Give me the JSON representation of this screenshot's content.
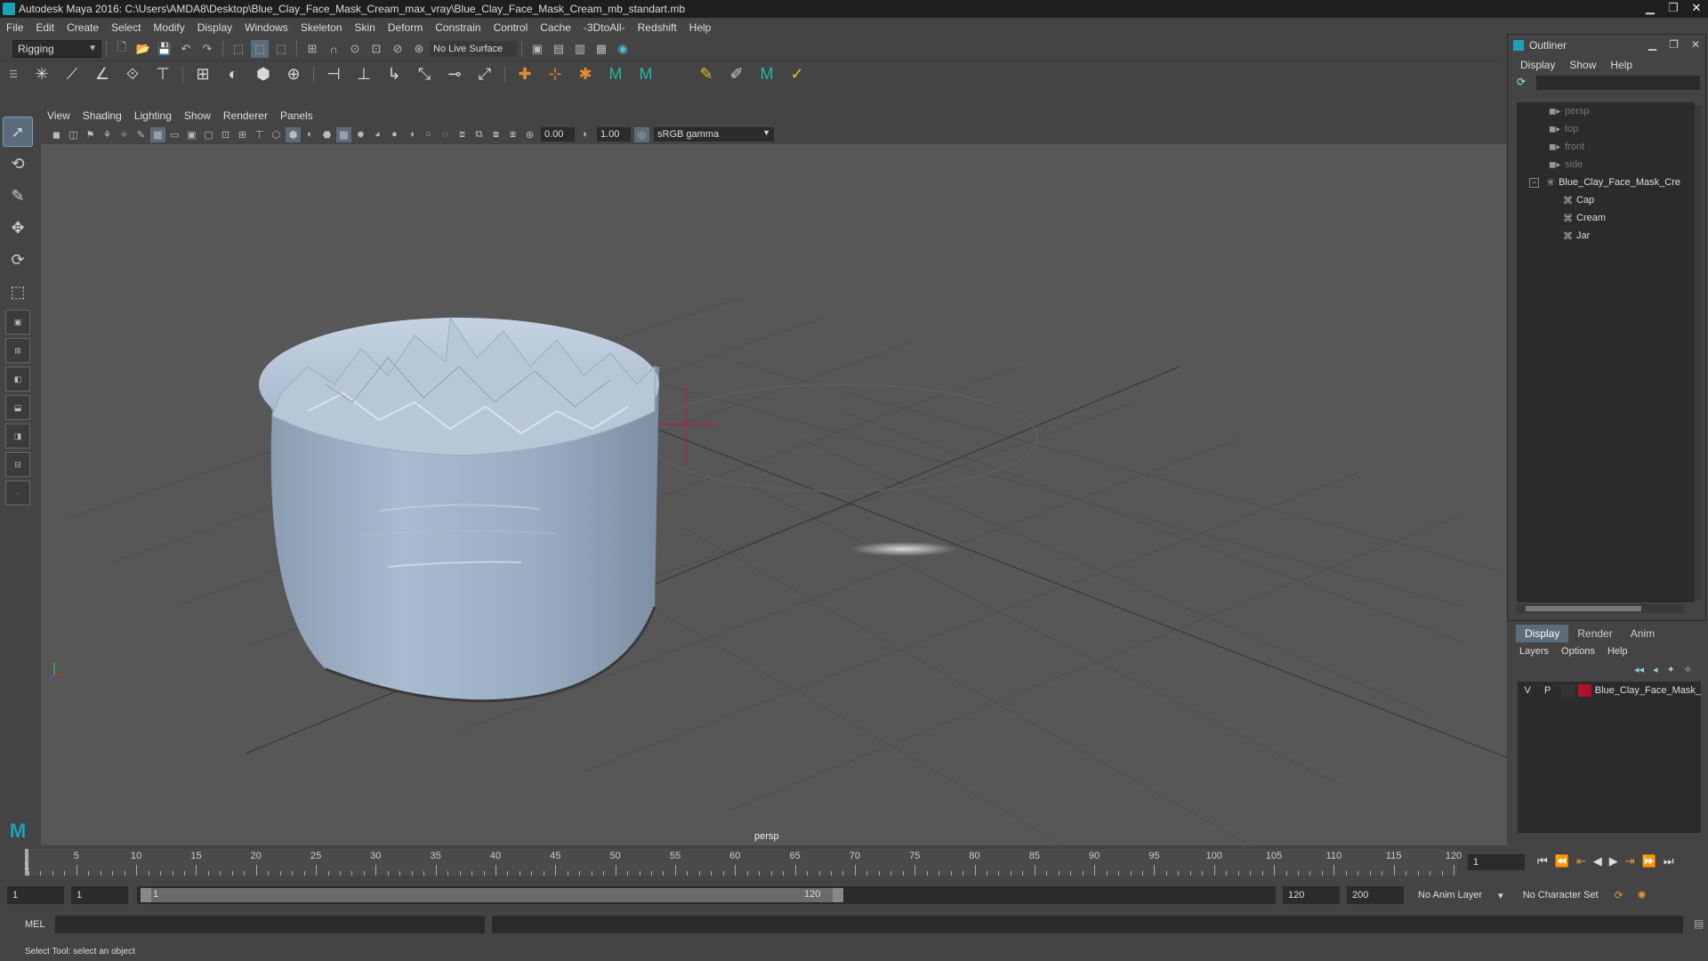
{
  "window": {
    "title": "Autodesk Maya 2016: C:\\Users\\AMDA8\\Desktop\\Blue_Clay_Face_Mask_Cream_max_vray\\Blue_Clay_Face_Mask_Cream_mb_standart.mb",
    "minimize": "▁",
    "restore": "❐",
    "close": "✕"
  },
  "menubar": [
    "File",
    "Edit",
    "Create",
    "Select",
    "Modify",
    "Display",
    "Windows",
    "Skeleton",
    "Skin",
    "Deform",
    "Constrain",
    "Control",
    "Cache",
    "-3DtoAll-",
    "Redshift",
    "Help"
  ],
  "statusline": {
    "mode": "Rigging",
    "live_surface": "No Live Surface"
  },
  "viewport": {
    "menu": [
      "View",
      "Shading",
      "Lighting",
      "Show",
      "Renderer",
      "Panels"
    ],
    "exposure": "0.00",
    "gamma_value": "1.00",
    "color_space": "sRGB gamma",
    "camera_label": "persp"
  },
  "outliner": {
    "title": "Outliner",
    "menu": [
      "Display",
      "Show",
      "Help"
    ],
    "items": [
      {
        "label": "persp",
        "kind": "camera"
      },
      {
        "label": "top",
        "kind": "camera"
      },
      {
        "label": "front",
        "kind": "camera"
      },
      {
        "label": "side",
        "kind": "camera"
      },
      {
        "label": "Blue_Clay_Face_Mask_Cre",
        "kind": "group"
      },
      {
        "label": "Cap",
        "kind": "mesh"
      },
      {
        "label": "Cream",
        "kind": "mesh"
      },
      {
        "label": "Jar",
        "kind": "mesh"
      }
    ]
  },
  "layers": {
    "tabs": [
      "Display",
      "Render",
      "Anim"
    ],
    "menu": [
      "Layers",
      "Options",
      "Help"
    ],
    "rows": [
      {
        "v": "V",
        "p": "P",
        "name": "Blue_Clay_Face_Mask_",
        "color": "#b0102a"
      }
    ]
  },
  "timeline": {
    "ticks": [
      "5",
      "10",
      "15",
      "20",
      "25",
      "30",
      "35",
      "40",
      "45",
      "50",
      "55",
      "60",
      "65",
      "70",
      "75",
      "80",
      "85",
      "90",
      "95",
      "100",
      "105",
      "110",
      "115",
      "120"
    ],
    "start_label": "1",
    "current_frame": "1"
  },
  "range": {
    "start": "1",
    "current": "1",
    "bar_start": "1",
    "bar_end": "120",
    "end": "120",
    "max": "200",
    "anim_layer": "No Anim Layer",
    "char_set": "No Character Set"
  },
  "cmdline": {
    "label": "MEL"
  },
  "helpline": {
    "text": "Select Tool: select an object"
  }
}
